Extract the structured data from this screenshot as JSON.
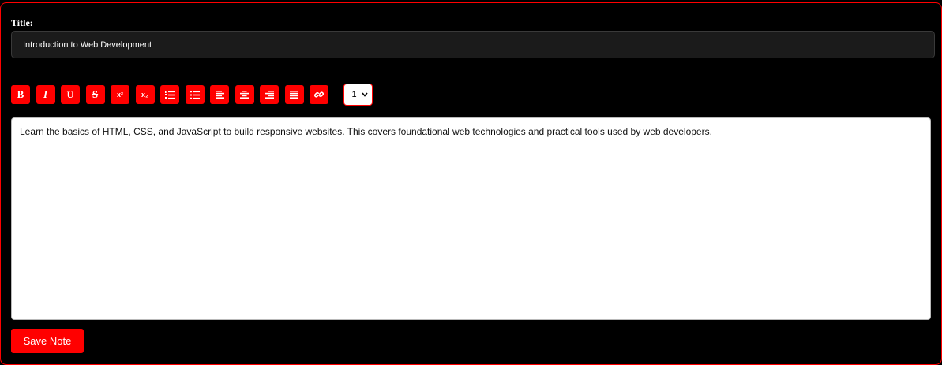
{
  "form": {
    "title_label": "Title:",
    "title_value": "Introduction to Web Development"
  },
  "toolbar": {
    "bold": "B",
    "italic": "I",
    "underline": "U",
    "strikethrough": "S",
    "superscript": "x²",
    "subscript": "x₂",
    "font_size_selected": "1"
  },
  "editor": {
    "content": "Learn the basics of HTML, CSS, and JavaScript to build responsive websites. This covers foundational web technologies and practical tools used by web developers."
  },
  "actions": {
    "save_label": "Save Note"
  },
  "colors": {
    "accent": "#ff0000",
    "background": "#000000",
    "input_background": "#1b1b1b",
    "editor_background": "#ffffff"
  },
  "icons": {
    "ordered_list": "ordered-list-icon",
    "unordered_list": "unordered-list-icon",
    "align_left": "align-left-icon",
    "align_center": "align-center-icon",
    "align_right": "align-right-icon",
    "align_justify": "align-justify-icon",
    "link": "link-icon"
  }
}
